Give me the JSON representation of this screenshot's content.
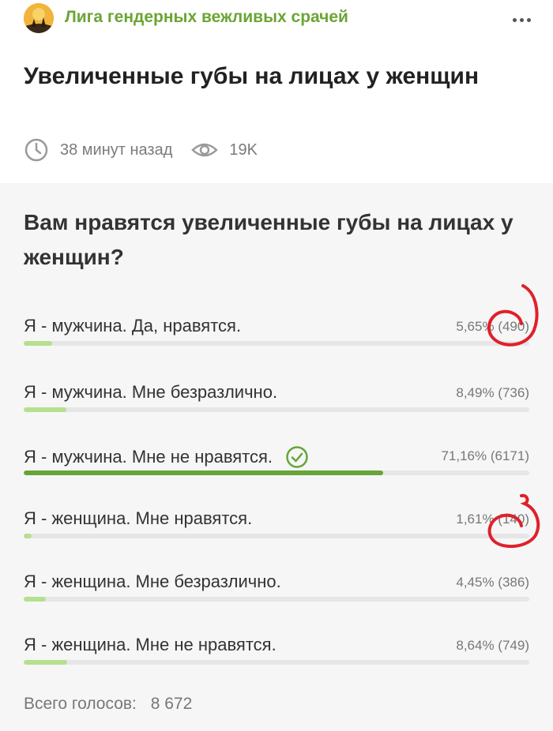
{
  "community": {
    "name": "Лига гендерных вежливых срачей"
  },
  "post": {
    "title": "Увеличенные губы на лицах у женщин",
    "time": "38 минут назад",
    "views": "19K"
  },
  "poll": {
    "question": "Вам нравятся увеличенные губы на лицах у женщин?",
    "options": [
      {
        "label": "Я - мужчина. Да, нравятся.",
        "stats": "5,65% (490)",
        "percent": 5.65,
        "voted": false,
        "leading": false
      },
      {
        "label": "Я - мужчина. Мне безразлично.",
        "stats": "8,49% (736)",
        "percent": 8.49,
        "voted": false,
        "leading": false
      },
      {
        "label": "Я - мужчина. Мне не нравятся.",
        "stats": "71,16% (6171)",
        "percent": 71.16,
        "voted": true,
        "leading": true
      },
      {
        "label": "Я - женщина. Мне нравятся.",
        "stats": "1,61% (140)",
        "percent": 1.61,
        "voted": false,
        "leading": false
      },
      {
        "label": "Я - женщина. Мне безразлично.",
        "stats": "4,45% (386)",
        "percent": 4.45,
        "voted": false,
        "leading": false
      },
      {
        "label": "Я - женщина. Мне не нравятся.",
        "stats": "8,64% (749)",
        "percent": 8.64,
        "voted": false,
        "leading": false
      }
    ],
    "total_label": "Всего голосов:",
    "total_value": "8 672"
  },
  "colors": {
    "community_green": "#6aa533",
    "bar_leading": "#66a536",
    "bar_other": "#b6df8f",
    "annotation_red": "#e0202a"
  },
  "icons": {
    "logo": "community-logo-icon",
    "more": "more-dots-icon",
    "time": "clock-icon",
    "views": "eye-icon",
    "voted": "check-circle-icon"
  }
}
